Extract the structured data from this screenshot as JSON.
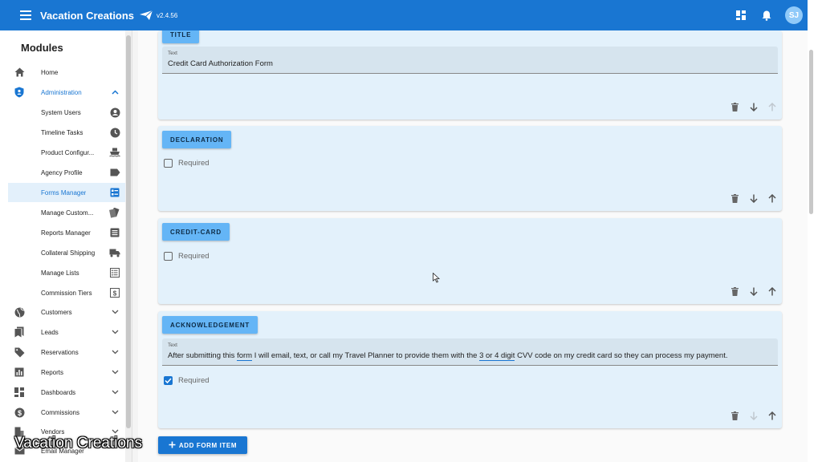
{
  "app": {
    "title": "Vacation Creations",
    "version": "v2.4.56",
    "user_initials": "SJ",
    "accent": "#1976d2"
  },
  "sidebar": {
    "title": "Modules",
    "items": [
      {
        "label": "Home",
        "icon": "home-icon"
      },
      {
        "label": "Administration",
        "icon": "shield-icon",
        "expanded": true
      },
      {
        "label": "System Users",
        "icon": "account-circle-icon"
      },
      {
        "label": "Timeline Tasks",
        "icon": "clock-icon"
      },
      {
        "label": "Product Configur...",
        "icon": "cruise-ship-icon"
      },
      {
        "label": "Agency Profile",
        "icon": "label-tag-icon"
      },
      {
        "label": "Forms Manager",
        "icon": "form-icon",
        "active": true
      },
      {
        "label": "Manage Custom...",
        "icon": "cards-icon"
      },
      {
        "label": "Reports Manager",
        "icon": "list-alt-icon"
      },
      {
        "label": "Collateral Shipping",
        "icon": "truck-icon"
      },
      {
        "label": "Manage Lists",
        "icon": "checklist-icon"
      },
      {
        "label": "Commission Tiers",
        "icon": "dollar-box-icon"
      },
      {
        "label": "Customers",
        "icon": "globe-icon"
      },
      {
        "label": "Leads",
        "icon": "bookmarks-icon"
      },
      {
        "label": "Reservations",
        "icon": "tag-icon"
      },
      {
        "label": "Reports",
        "icon": "bar-chart-icon"
      },
      {
        "label": "Dashboards",
        "icon": "dashboard-icon"
      },
      {
        "label": "Commissions",
        "icon": "dollar-circle-icon"
      },
      {
        "label": "Vendors",
        "icon": "building-icon"
      },
      {
        "label": "Email Manager",
        "icon": "email-icon"
      }
    ]
  },
  "form": {
    "items": [
      {
        "chip": "TITLE",
        "field_label": "Text",
        "field_value": "Credit Card Authorization Form",
        "up_enabled": false,
        "down_enabled": true
      },
      {
        "chip": "DECLARATION",
        "required_label": "Required",
        "required": false,
        "up_enabled": true,
        "down_enabled": true
      },
      {
        "chip": "CREDIT-CARD",
        "required_label": "Required",
        "required": false,
        "up_enabled": true,
        "down_enabled": true
      },
      {
        "chip": "ACKNOWLEDGEMENT",
        "field_label": "Text",
        "field_value_parts": [
          "After submitting this ",
          "form",
          " I will email, text, or call my Travel Planner to provide them with the ",
          "3 or 4 digit",
          " CVV code on my credit card so they can process my payment."
        ],
        "required_label": "Required",
        "required": true,
        "up_enabled": true,
        "down_enabled": false
      }
    ],
    "add_button": "ADD FORM ITEM"
  },
  "watermark": "Vacation Creations"
}
